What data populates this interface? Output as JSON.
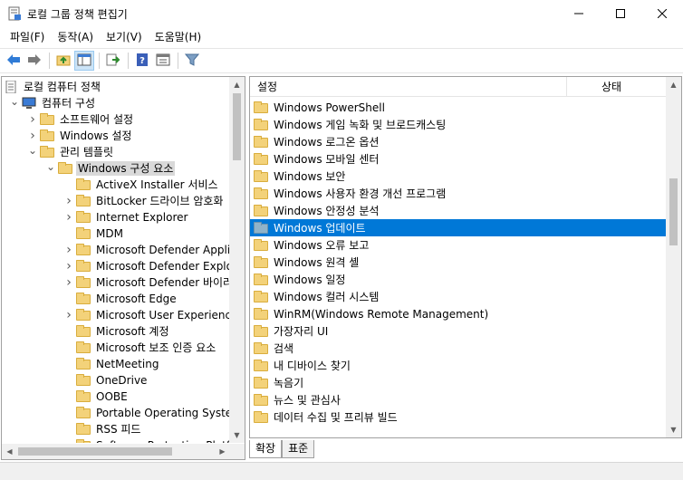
{
  "window": {
    "title": "로컬 그룹 정책 편집기"
  },
  "menu": [
    "파일(F)",
    "동작(A)",
    "보기(V)",
    "도움말(H)"
  ],
  "tree": [
    {
      "label": "로컬 컴퓨터 정책",
      "depth": 0,
      "expander": "",
      "icon": "policy"
    },
    {
      "label": "컴퓨터 구성",
      "depth": 1,
      "expander": "open",
      "icon": "computer"
    },
    {
      "label": "소프트웨어 설정",
      "depth": 2,
      "expander": "closed",
      "icon": "folder"
    },
    {
      "label": "Windows 설정",
      "depth": 2,
      "expander": "closed",
      "icon": "folder"
    },
    {
      "label": "관리 템플릿",
      "depth": 2,
      "expander": "open",
      "icon": "folder"
    },
    {
      "label": "Windows 구성 요소",
      "depth": 3,
      "expander": "open",
      "icon": "folder",
      "selected": true
    },
    {
      "label": "ActiveX Installer 서비스",
      "depth": 4,
      "expander": "",
      "icon": "folder"
    },
    {
      "label": "BitLocker 드라이브 암호화",
      "depth": 4,
      "expander": "closed",
      "icon": "folder"
    },
    {
      "label": "Internet Explorer",
      "depth": 4,
      "expander": "closed",
      "icon": "folder"
    },
    {
      "label": "MDM",
      "depth": 4,
      "expander": "",
      "icon": "folder"
    },
    {
      "label": "Microsoft Defender Applica",
      "depth": 4,
      "expander": "closed",
      "icon": "folder"
    },
    {
      "label": "Microsoft Defender Exploit",
      "depth": 4,
      "expander": "closed",
      "icon": "folder"
    },
    {
      "label": "Microsoft Defender 바이러스",
      "depth": 4,
      "expander": "closed",
      "icon": "folder"
    },
    {
      "label": "Microsoft Edge",
      "depth": 4,
      "expander": "",
      "icon": "folder"
    },
    {
      "label": "Microsoft User Experience V",
      "depth": 4,
      "expander": "closed",
      "icon": "folder"
    },
    {
      "label": "Microsoft 계정",
      "depth": 4,
      "expander": "",
      "icon": "folder"
    },
    {
      "label": "Microsoft 보조 인증 요소",
      "depth": 4,
      "expander": "",
      "icon": "folder"
    },
    {
      "label": "NetMeeting",
      "depth": 4,
      "expander": "",
      "icon": "folder"
    },
    {
      "label": "OneDrive",
      "depth": 4,
      "expander": "",
      "icon": "folder"
    },
    {
      "label": "OOBE",
      "depth": 4,
      "expander": "",
      "icon": "folder"
    },
    {
      "label": "Portable Operating System",
      "depth": 4,
      "expander": "",
      "icon": "folder"
    },
    {
      "label": "RSS 피드",
      "depth": 4,
      "expander": "",
      "icon": "folder"
    },
    {
      "label": "Software Protection Platform",
      "depth": 4,
      "expander": "",
      "icon": "folder"
    }
  ],
  "list_header": {
    "setting": "설정",
    "state": "상태"
  },
  "list": [
    {
      "label": "Windows PowerShell"
    },
    {
      "label": "Windows 게임 녹화 및 브로드캐스팅"
    },
    {
      "label": "Windows 로그온 옵션"
    },
    {
      "label": "Windows 모바일 센터"
    },
    {
      "label": "Windows 보안"
    },
    {
      "label": "Windows 사용자 환경 개선 프로그램"
    },
    {
      "label": "Windows 안정성 분석"
    },
    {
      "label": "Windows 업데이트",
      "selected": true
    },
    {
      "label": "Windows 오류 보고"
    },
    {
      "label": "Windows 원격 셸"
    },
    {
      "label": "Windows 일정"
    },
    {
      "label": "Windows 컬러 시스템"
    },
    {
      "label": "WinRM(Windows Remote Management)"
    },
    {
      "label": "가장자리 UI"
    },
    {
      "label": "검색"
    },
    {
      "label": "내 디바이스 찾기"
    },
    {
      "label": "녹음기"
    },
    {
      "label": "뉴스 및 관심사"
    },
    {
      "label": "데이터 수집 및 프리뷰 빌드"
    }
  ],
  "tabs": [
    {
      "label": "확장",
      "active": true
    },
    {
      "label": "표준",
      "active": false
    }
  ],
  "colors": {
    "selection": "#0078d7",
    "tree_selection": "#d9d9d9",
    "folder": "#f3d27a"
  },
  "icons": [
    "back-icon",
    "forward-icon",
    "up-folder-icon",
    "show-hide-tree-icon",
    "export-list-icon",
    "help-icon",
    "properties-icon",
    "filter-icon"
  ]
}
